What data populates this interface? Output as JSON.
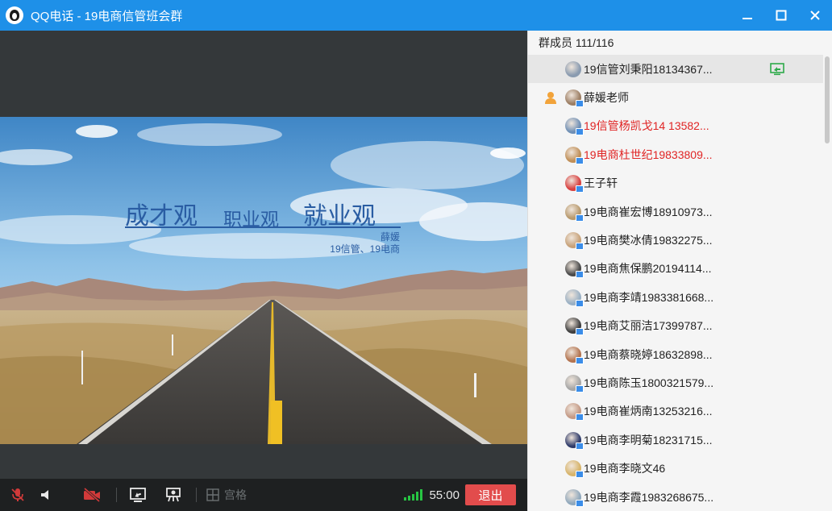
{
  "window": {
    "title": "QQ电话 - 19电商信管班会群",
    "minimize_icon": "minimize-icon",
    "maximize_icon": "maximize-icon",
    "close_icon": "close-icon"
  },
  "slide": {
    "title_1": "成才观",
    "title_2": "职业观",
    "title_3": "就业观",
    "author": "薛媛",
    "subtitle": "19信管、19电商"
  },
  "toolbar": {
    "mic_icon": "mic-muted-icon",
    "speaker_icon": "speaker-icon",
    "camera_icon": "camera-off-icon",
    "share_icon": "screen-share-icon",
    "present_icon": "presenter-icon",
    "grid_label": "宫格",
    "timer": "55:00",
    "exit_label": "退出",
    "signal_color": "#27c443",
    "exit_color": "#e24c4c"
  },
  "members_panel": {
    "header": "群成员 111/116",
    "members": [
      {
        "name": "19信管刘秉阳18134367...",
        "highlighted": true,
        "sharing": true
      },
      {
        "name": "薛媛老师",
        "owner": true
      },
      {
        "name": "19信管杨凯戈14  13582...",
        "red": true
      },
      {
        "name": "19电商杜世纪19833809...",
        "red": true
      },
      {
        "name": "王子轩"
      },
      {
        "name": "19电商崔宏博18910973..."
      },
      {
        "name": "19电商樊冰倩19832275..."
      },
      {
        "name": "19电商焦保鹏20194114..."
      },
      {
        "name": "19电商李靖1983381668..."
      },
      {
        "name": "19电商艾丽洁17399787..."
      },
      {
        "name": "19电商蔡晓婷18632898..."
      },
      {
        "name": "19电商陈玉1800321579..."
      },
      {
        "name": "19电商崔炳南13253216..."
      },
      {
        "name": "19电商李明菊18231715..."
      },
      {
        "name": "19电商李晓文46"
      },
      {
        "name": "19电商李霞1983268675..."
      }
    ]
  }
}
